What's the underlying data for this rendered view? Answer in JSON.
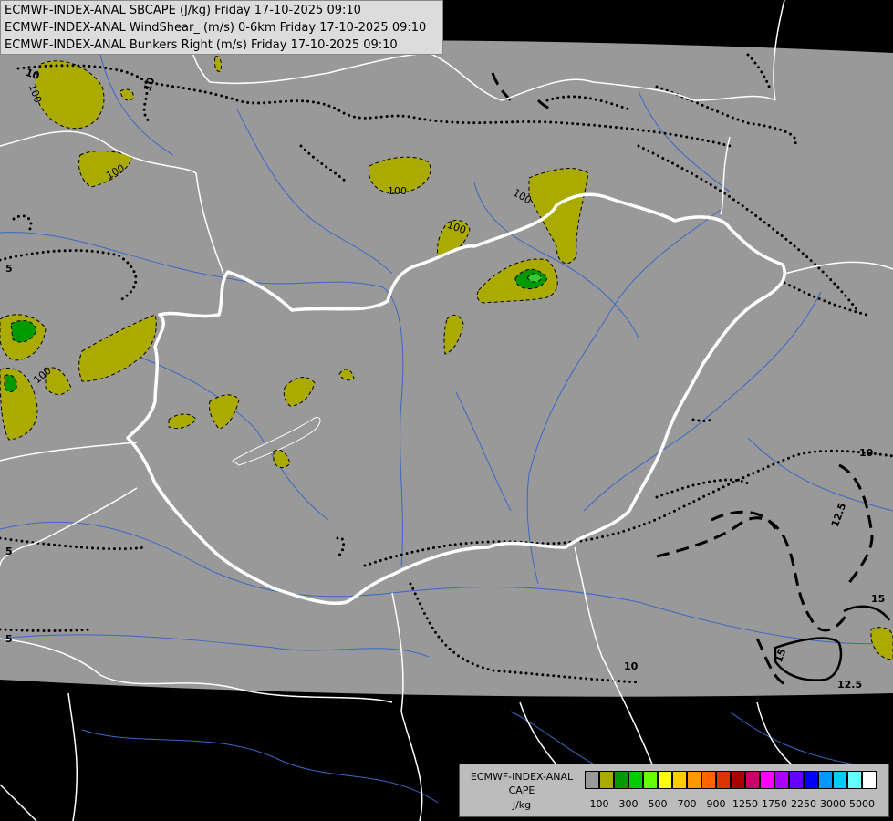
{
  "header": {
    "line1": "ECMWF-INDEX-ANAL SBCAPE (J/kg) Friday 17-10-2025 09:10",
    "line2": "ECMWF-INDEX-ANAL WindShear_ (m/s) 0-6km Friday 17-10-2025 09:10",
    "line3": "ECMWF-INDEX-ANAL Bunkers Right (m/s) Friday 17-10-2025 09:10"
  },
  "legend": {
    "label1": "ECMWF-INDEX-ANAL",
    "label2": "CAPE",
    "label3": "J/kg",
    "colors": [
      "#999999",
      "#aaaa00",
      "#009900",
      "#00cc00",
      "#66ff00",
      "#ffff00",
      "#ffcc00",
      "#ff9900",
      "#ff6600",
      "#dd3300",
      "#aa0000",
      "#cc0066",
      "#ff00ff",
      "#aa00ff",
      "#6600ff",
      "#0000ff",
      "#0099ff",
      "#00ccff",
      "#66ffff",
      "#ffffff"
    ],
    "ticks": [
      "100",
      "300",
      "500",
      "700",
      "900",
      "1250",
      "1750",
      "2250",
      "3000",
      "5000"
    ]
  },
  "contour_labels": {
    "l10a": "10",
    "l100a": "100",
    "l100b": "100",
    "l100c": "100",
    "l100d": "100",
    "l100e": "100",
    "l100f": "100",
    "l10b": "10",
    "l10c": "10",
    "l10d": "10",
    "l5a": "5",
    "l5b": "5",
    "l5c": "5",
    "l125a": "12.5",
    "l125b": "12.5",
    "l15a": "15",
    "l15b": "15"
  },
  "colors": {
    "domain_gray": "#999999",
    "outside": "#000000",
    "cape_low": "#aaaa00",
    "cape_mid": "#009900",
    "cape_high": "#33cc33",
    "border": "#ffffff",
    "river": "#3366cc"
  }
}
